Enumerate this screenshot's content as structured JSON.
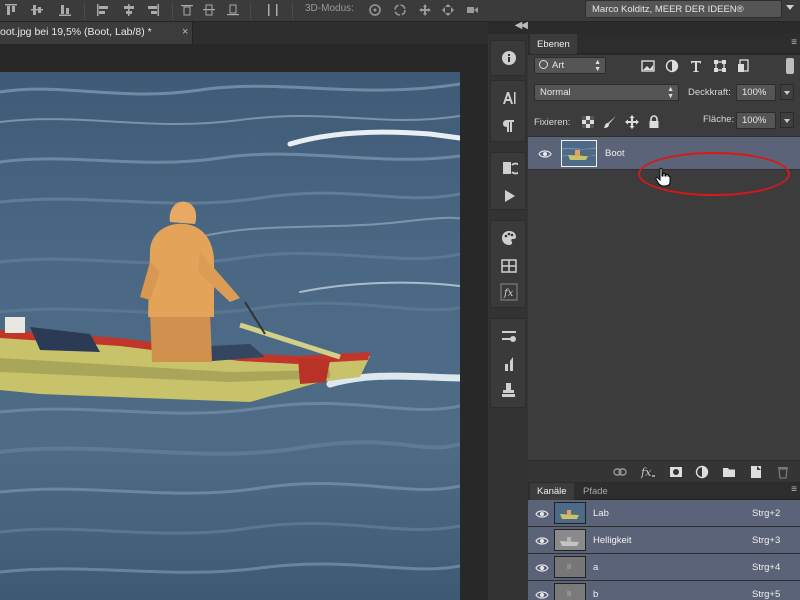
{
  "options_bar": {
    "mode_3d_label": "3D-Modus:",
    "workspace": "Marco Kolditz, MEER DER IDEEN®"
  },
  "document": {
    "tab_title": "oot.jpg bei 19,5% (Boot, Lab/8) *",
    "close_glyph": "×"
  },
  "layers_panel": {
    "tab_label": "Ebenen",
    "filter_kind": "Art",
    "blend_mode": "Normal",
    "opacity_label": "Deckkraft:",
    "opacity_value": "100%",
    "lock_label": "Fixieren:",
    "fill_label": "Fläche:",
    "fill_value": "100%",
    "layers": [
      {
        "name": "Boot",
        "visible": true,
        "selected": true
      }
    ],
    "filter_icons": [
      "image-filter-icon",
      "adjustment-filter-icon",
      "type-filter-icon",
      "shape-filter-icon",
      "smartobject-filter-icon"
    ],
    "lock_icons": [
      "lock-transparent-icon",
      "lock-image-icon",
      "lock-position-icon",
      "lock-all-icon"
    ],
    "footer_icons": [
      "link-layers-icon",
      "fx-icon",
      "add-mask-icon",
      "new-adjustment-icon",
      "new-group-icon",
      "new-layer-icon",
      "delete-layer-icon"
    ]
  },
  "channels_panel": {
    "tabs": [
      "Kanäle",
      "Pfade"
    ],
    "channels": [
      {
        "name": "Lab",
        "shortcut": "Strg+2"
      },
      {
        "name": "Helligkeit",
        "shortcut": "Strg+3"
      },
      {
        "name": "a",
        "shortcut": "Strg+4"
      },
      {
        "name": "b",
        "shortcut": "Strg+5"
      }
    ]
  },
  "colors": {
    "selection_row": "#5b6378",
    "annotation_ellipse": "#d81818",
    "panel_bg": "#3c3c3c"
  }
}
